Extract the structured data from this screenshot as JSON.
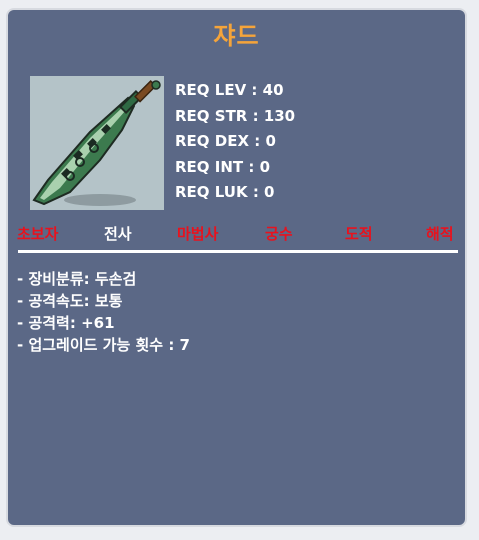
{
  "item": {
    "name": "쟈드",
    "image_icon": "two-handed-sword-icon"
  },
  "requirements": [
    {
      "text": "REQ LEV : 40"
    },
    {
      "text": "REQ STR : 130"
    },
    {
      "text": "REQ DEX : 0"
    },
    {
      "text": "REQ INT : 0"
    },
    {
      "text": "REQ LUK : 0"
    }
  ],
  "jobs": [
    {
      "label": "초보자",
      "color": "#e8121e",
      "available": false
    },
    {
      "label": "전사",
      "color": "#ffffff",
      "available": true
    },
    {
      "label": "마법사",
      "color": "#e8121e",
      "available": false
    },
    {
      "label": "궁수",
      "color": "#e8121e",
      "available": false
    },
    {
      "label": "도적",
      "color": "#e8121e",
      "available": false
    },
    {
      "label": "해적",
      "color": "#e8121e",
      "available": false
    }
  ],
  "stats": [
    {
      "text": "- 장비분류: 두손검"
    },
    {
      "text": "- 공격속도: 보통"
    },
    {
      "text": "- 공격력: +61"
    },
    {
      "text": "- 업그레이드 가능 횟수 : 7"
    }
  ],
  "colors": {
    "title": "#f5a43a",
    "panel_bg": "#5b6886",
    "unavailable_job": "#e8121e",
    "available_job": "#ffffff"
  }
}
